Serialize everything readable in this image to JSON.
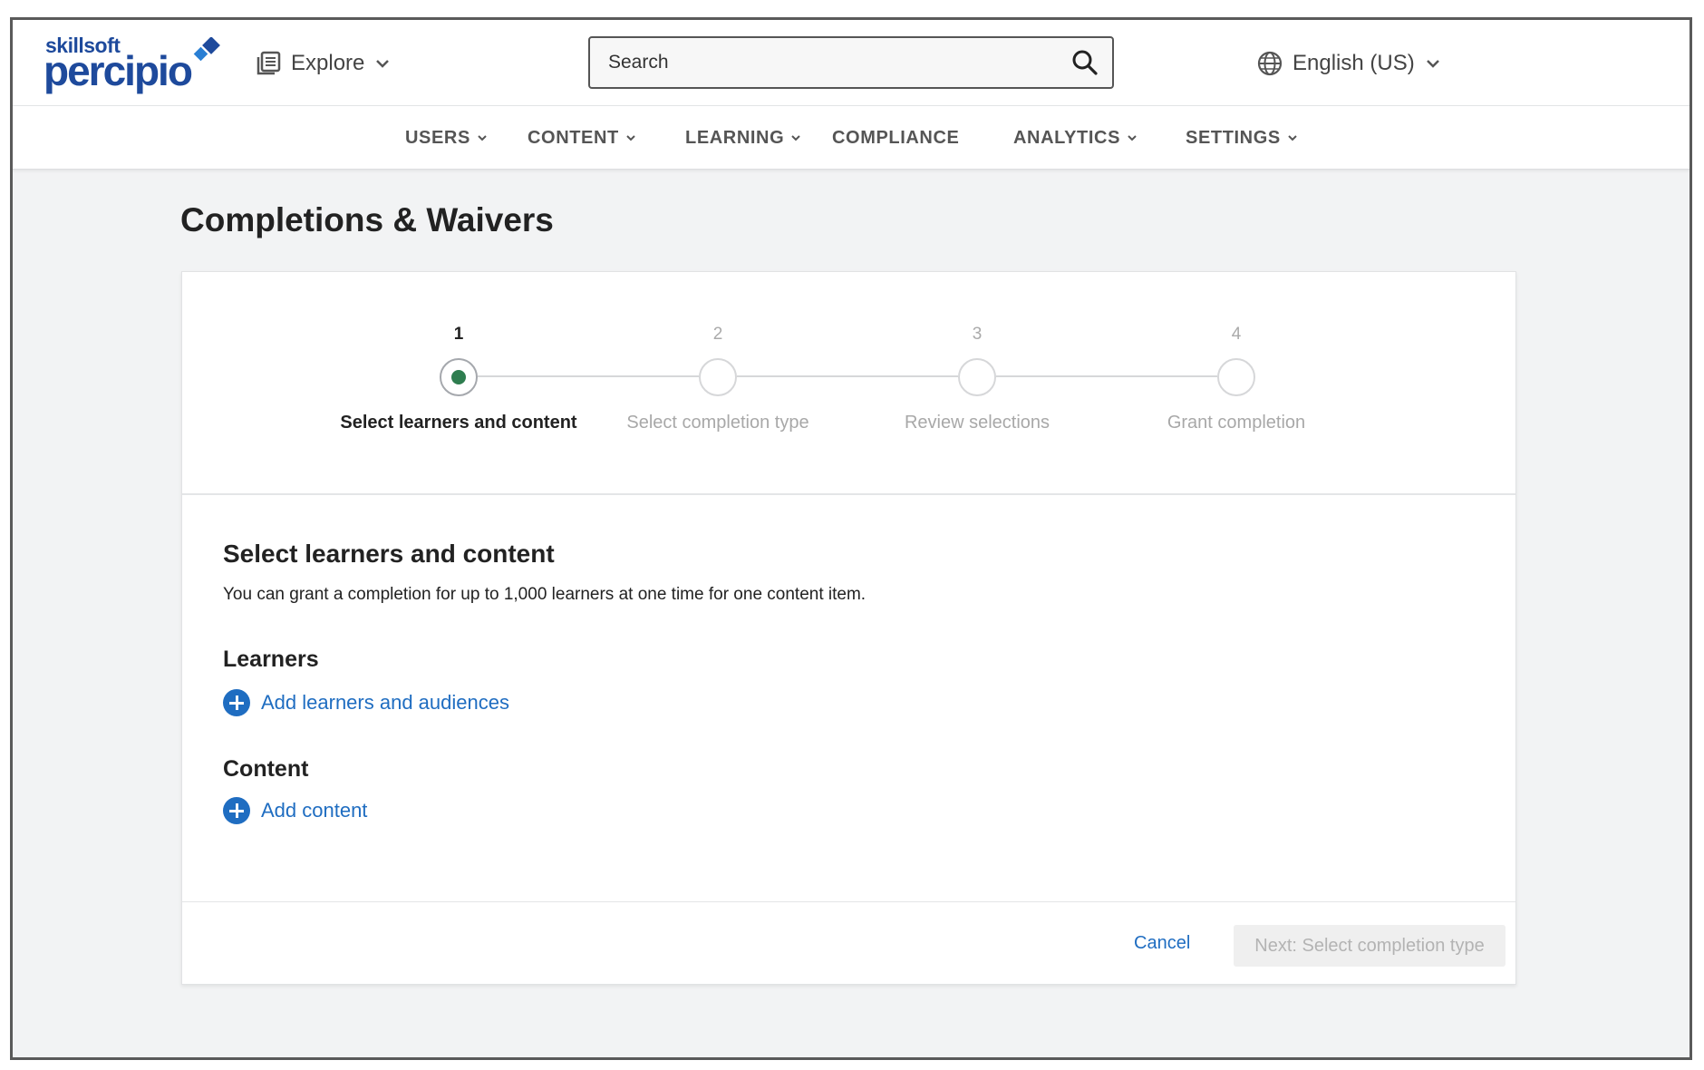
{
  "brand": {
    "small": "skillsoft",
    "big": "percipio",
    "colors": {
      "primary": "#1e4a9c",
      "mark_dark": "#1e4a9c",
      "mark_light": "#2a7fd4"
    }
  },
  "header": {
    "explore": {
      "label": "Explore",
      "icon": "library-icon"
    },
    "search": {
      "placeholder": "Search",
      "icon": "search-icon"
    },
    "language": {
      "label": "English (US)",
      "icon": "globe-icon"
    }
  },
  "nav": {
    "items": [
      {
        "label": "USERS",
        "has_dropdown": true
      },
      {
        "label": "CONTENT",
        "has_dropdown": true
      },
      {
        "label": "LEARNING",
        "has_dropdown": true
      },
      {
        "label": "COMPLIANCE",
        "has_dropdown": false
      },
      {
        "label": "ANALYTICS",
        "has_dropdown": true
      },
      {
        "label": "SETTINGS",
        "has_dropdown": true
      }
    ]
  },
  "page": {
    "title": "Completions & Waivers"
  },
  "stepper": {
    "steps": [
      {
        "number": "1",
        "label": "Select learners and content",
        "active": true
      },
      {
        "number": "2",
        "label": "Select completion type",
        "active": false
      },
      {
        "number": "3",
        "label": "Review selections",
        "active": false
      },
      {
        "number": "4",
        "label": "Grant completion",
        "active": false
      }
    ],
    "active_color": "#2e7d4f"
  },
  "form": {
    "title": "Select learners and content",
    "description": "You can grant a completion for up to 1,000 learners at one time for one content item.",
    "learners": {
      "heading": "Learners",
      "add_label": "Add learners and audiences"
    },
    "content": {
      "heading": "Content",
      "add_label": "Add content"
    },
    "link_color": "#1f6dc1"
  },
  "footer": {
    "cancel_label": "Cancel",
    "next_label": "Next: Select completion type"
  }
}
